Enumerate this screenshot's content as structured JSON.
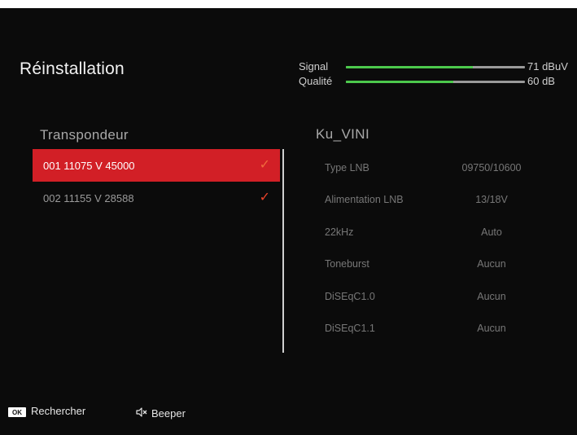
{
  "page": {
    "title": "Réinstallation"
  },
  "meters": {
    "signal": {
      "label": "Signal",
      "value": "71 dBuV",
      "level": 0.71,
      "color": "#4cc94c"
    },
    "quality": {
      "label": "Qualité",
      "value": "60 dB",
      "level": 0.6,
      "color": "#4cc94c"
    }
  },
  "transponders": {
    "header": "Transpondeur",
    "items": [
      {
        "label": "001 11075 V 45000",
        "checked": true,
        "selected": true
      },
      {
        "label": "002 11155 V 28588",
        "checked": true,
        "selected": false
      }
    ]
  },
  "satellite": {
    "name": "Ku_VINI",
    "params": [
      {
        "label": "Type LNB",
        "value": "09750/10600"
      },
      {
        "label": "Alimentation LNB",
        "value": "13/18V"
      },
      {
        "label": "22kHz",
        "value": "Auto"
      },
      {
        "label": "Toneburst",
        "value": "Aucun"
      },
      {
        "label": "DiSEqC1.0",
        "value": "Aucun"
      },
      {
        "label": "DiSEqC1.1",
        "value": "Aucun"
      }
    ]
  },
  "footer": {
    "ok_key": "OK",
    "search_label": "Rechercher",
    "beeper_label": "Beeper",
    "beeper_icon": "speaker-muted-icon"
  },
  "colors": {
    "selection": "#d21f26",
    "check": "#e9432a",
    "background": "#0b0b0b"
  }
}
